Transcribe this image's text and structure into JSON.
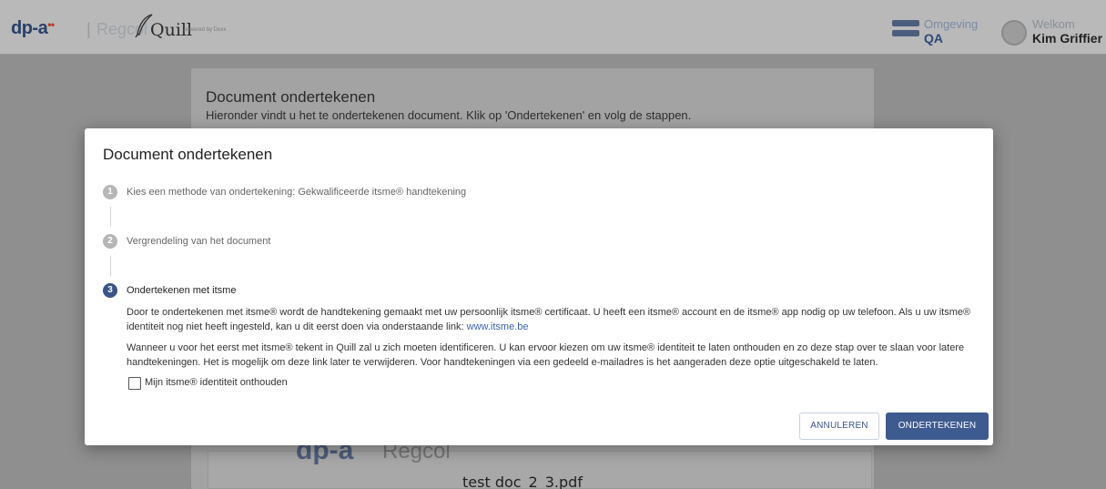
{
  "header": {
    "brand": "dp-a",
    "brand_mark": "••",
    "separator": "|",
    "partner": "Regcol",
    "app_name": "Quill",
    "powered_by": "powered by Doxx",
    "environment_label": "Omgeving",
    "environment_value": "QA",
    "welcome_label": "Welkom",
    "user_name": "Kim Griffier"
  },
  "background_page": {
    "title": "Document ondertekenen",
    "subtitle": "Hieronder vindt u het te ondertekenen document. Klik op 'Ondertekenen' en volg de stappen.",
    "logo_text": "dp-a",
    "logo_partner": "Regcol",
    "file_name": "test doc_2_3.pdf"
  },
  "modal": {
    "title": "Document ondertekenen",
    "steps": [
      {
        "number": "1",
        "label": "Kies een methode van ondertekening: Gekwalificeerde itsme® handtekening",
        "state": "done"
      },
      {
        "number": "2",
        "label": "Vergrendeling van het document",
        "state": "done"
      },
      {
        "number": "3",
        "label": "Ondertekenen met itsme",
        "state": "active"
      }
    ],
    "paragraph1": "Door te ondertekenen met itsme® wordt de handtekening gemaakt met uw persoonlijk itsme® certificaat. U heeft een itsme® account en de itsme® app nodig op uw telefoon. Als u uw itsme® identiteit nog niet heeft ingesteld, kan u dit eerst doen via onderstaande link:",
    "link_text": "www.itsme.be",
    "paragraph2": "Wanneer u voor het eerst met itsme® tekent in Quill zal u zich moeten identificeren. U kan ervoor kiezen om uw itsme® identiteit te laten onthouden en zo deze stap over te slaan voor latere handtekeningen. Het is mogelijk om deze link later te verwijderen. Voor handtekeningen via een gedeeld e-mailadres is het aangeraden deze optie uitgeschakeld te laten.",
    "checkbox_label": "Mijn itsme® identiteit onthouden",
    "checkbox_checked": false,
    "cancel_label": "ANNULEREN",
    "sign_label": "ONDERTEKENEN"
  },
  "colors": {
    "primary": "#3e5b8f",
    "overlay": "#8f8f8f",
    "step_inactive": "#b6b6b6",
    "link": "#3a62a8"
  },
  "icons": [
    "quill-feather-icon",
    "environment-toggle-icon",
    "user-avatar-icon",
    "step-number-icon"
  ]
}
